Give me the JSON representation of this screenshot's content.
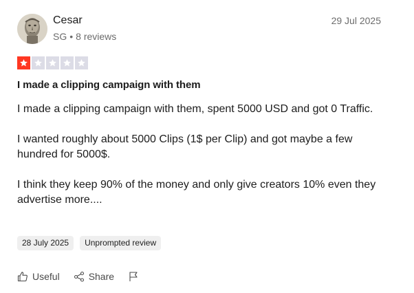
{
  "author": {
    "name": "Cesar",
    "country": "SG",
    "reviews_count": "8 reviews",
    "meta_separator": "•"
  },
  "review": {
    "date": "29 Jul 2025",
    "rating": 1,
    "rating_max": 5,
    "title": "I made a clipping campaign with them",
    "paragraphs": [
      "I made a clipping campaign with them, spent 5000 USD and got 0 Traffic.",
      "I wanted roughly about 5000 Clips (1$ per Clip) and got maybe a few hundred for 5000$.",
      "I think they keep 90% of the money and only give creators 10% even they advertise more...."
    ],
    "experience_date": "28 July 2025",
    "review_type": "Unprompted review"
  },
  "actions": {
    "useful_label": "Useful",
    "share_label": "Share"
  },
  "colors": {
    "star_filled": "#ff3722",
    "star_empty": "#dcdce6",
    "text_primary": "#1c1c1c",
    "text_secondary": "#6b6b6b",
    "tag_bg": "#efefef"
  },
  "icons": {
    "useful": "thumbs-up-icon",
    "share": "share-icon",
    "report": "flag-icon"
  }
}
